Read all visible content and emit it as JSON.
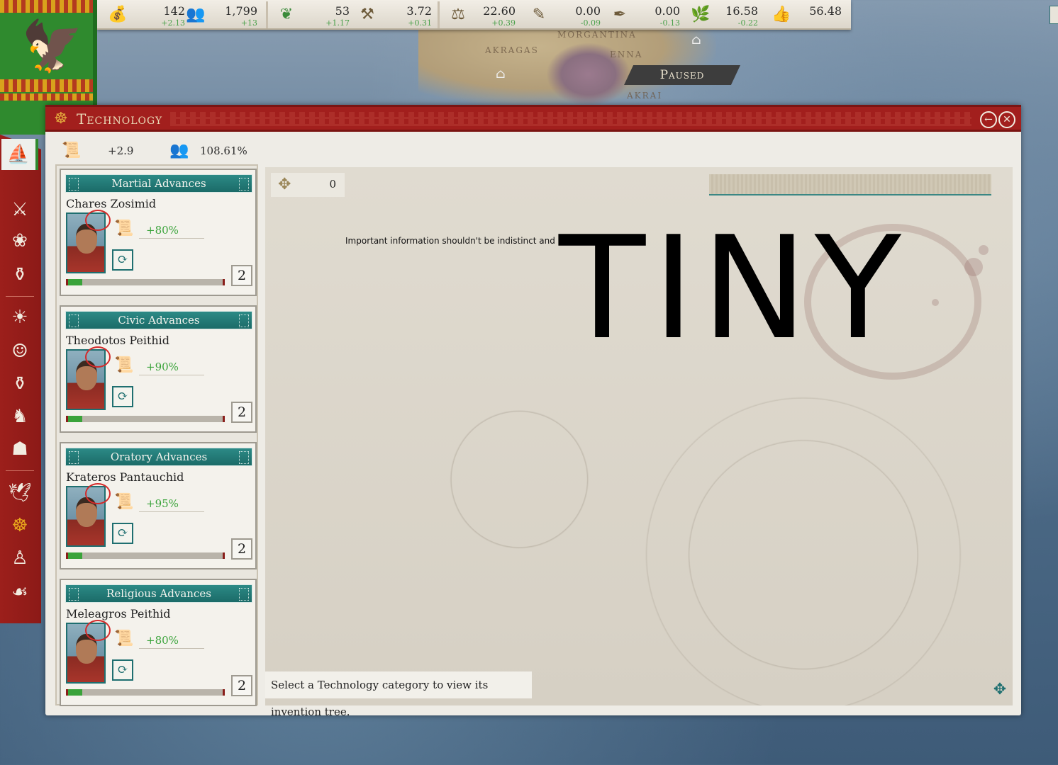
{
  "map": {
    "labels": [
      "AKRAGAS",
      "MORGANTINA",
      "ENNA",
      "AKRAI"
    ],
    "paused_label": "Paused"
  },
  "topbar": {
    "resources": [
      {
        "icon": "coin-bag-icon",
        "value": "142",
        "delta": "+2.13"
      },
      {
        "icon": "population-icon",
        "value": "1,799",
        "delta": "+13"
      },
      {
        "icon": "laurel-icon",
        "value": "53",
        "delta": "+1.17"
      },
      {
        "icon": "military-power-icon",
        "value": "3.72",
        "delta": "+0.31"
      },
      {
        "icon": "balance-icon",
        "value": "22.60",
        "delta": "+0.39"
      },
      {
        "icon": "civic-power-icon",
        "value": "0.00",
        "delta": "-0.09"
      },
      {
        "icon": "oratory-power-icon",
        "value": "0.00",
        "delta": "-0.13"
      },
      {
        "icon": "religious-power-icon",
        "value": "16.58",
        "delta": "-0.22"
      },
      {
        "icon": "thumbs-up-icon",
        "value": "56.48",
        "delta": ""
      }
    ]
  },
  "window": {
    "title": "Technology",
    "research_rate": "+2.9",
    "research_efficiency": "108.61%",
    "inventions_count": "0",
    "search_placeholder": "",
    "hint": "Select a Technology category to view its invention tree.",
    "annotation_small": "Important information shouldn't be indistinct and",
    "annotation_big": "TINY",
    "categories": [
      {
        "title": "Martial Advances",
        "researcher": "Chares Zosimid",
        "bonus": "+80%",
        "level": "2",
        "progress": 0.09
      },
      {
        "title": "Civic Advances",
        "researcher": "Theodotos Peithid",
        "bonus": "+90%",
        "level": "2",
        "progress": 0.09
      },
      {
        "title": "Oratory Advances",
        "researcher": "Krateros Pantauchid",
        "bonus": "+95%",
        "level": "2",
        "progress": 0.09
      },
      {
        "title": "Religious Advances",
        "researcher": "Meleagros Peithid",
        "bonus": "+80%",
        "level": "2",
        "progress": 0.09
      }
    ]
  },
  "colors": {
    "accent_teal": "#1f6f70",
    "title_red": "#a21f1d",
    "positive_green": "#3aa33a"
  }
}
